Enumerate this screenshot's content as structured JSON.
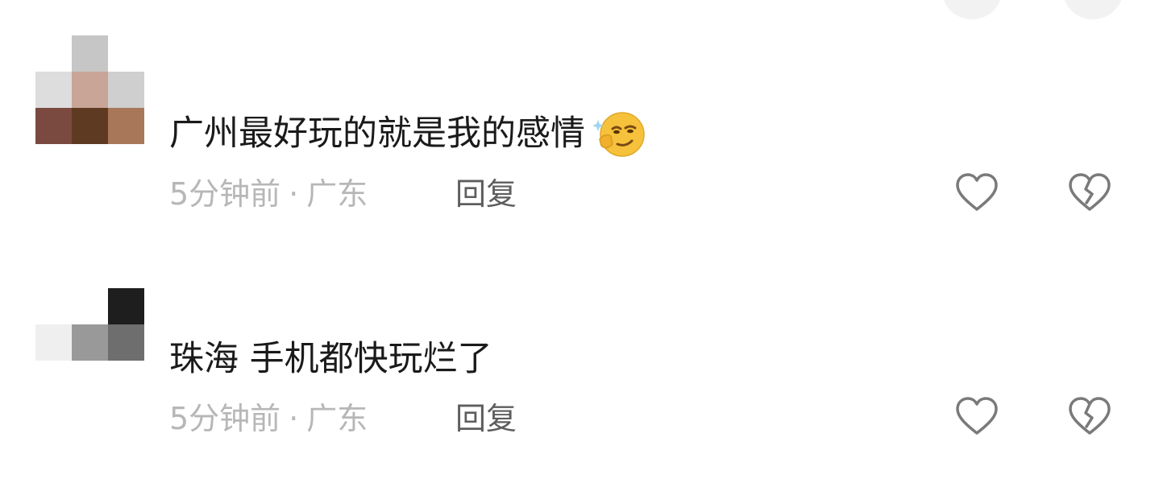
{
  "comments": [
    {
      "text": "广州最好玩的就是我的感情",
      "emoji": "smirk-emoji",
      "time": "5分钟前",
      "separator": "·",
      "location": "广东",
      "reply_label": "回复"
    },
    {
      "text": "珠海 手机都快玩烂了",
      "time": "5分钟前",
      "separator": "·",
      "location": "广东",
      "reply_label": "回复"
    }
  ],
  "icons": {
    "like": "heart-outline-icon",
    "dislike": "broken-heart-icon"
  },
  "colors": {
    "text": "#1a1a1a",
    "meta": "#b7b7b7",
    "reply": "#5e5e5e",
    "icon": "#7a7a7a",
    "emoji": "#f6c23c"
  }
}
